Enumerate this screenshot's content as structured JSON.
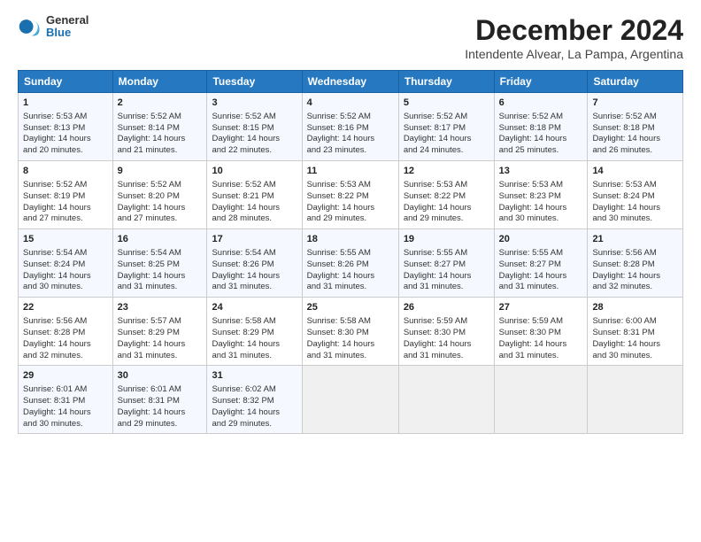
{
  "logo": {
    "general": "General",
    "blue": "Blue"
  },
  "title": "December 2024",
  "subtitle": "Intendente Alvear, La Pampa, Argentina",
  "days_header": [
    "Sunday",
    "Monday",
    "Tuesday",
    "Wednesday",
    "Thursday",
    "Friday",
    "Saturday"
  ],
  "weeks": [
    [
      {
        "day": "1",
        "lines": [
          "Sunrise: 5:53 AM",
          "Sunset: 8:13 PM",
          "Daylight: 14 hours",
          "and 20 minutes."
        ]
      },
      {
        "day": "2",
        "lines": [
          "Sunrise: 5:52 AM",
          "Sunset: 8:14 PM",
          "Daylight: 14 hours",
          "and 21 minutes."
        ]
      },
      {
        "day": "3",
        "lines": [
          "Sunrise: 5:52 AM",
          "Sunset: 8:15 PM",
          "Daylight: 14 hours",
          "and 22 minutes."
        ]
      },
      {
        "day": "4",
        "lines": [
          "Sunrise: 5:52 AM",
          "Sunset: 8:16 PM",
          "Daylight: 14 hours",
          "and 23 minutes."
        ]
      },
      {
        "day": "5",
        "lines": [
          "Sunrise: 5:52 AM",
          "Sunset: 8:17 PM",
          "Daylight: 14 hours",
          "and 24 minutes."
        ]
      },
      {
        "day": "6",
        "lines": [
          "Sunrise: 5:52 AM",
          "Sunset: 8:18 PM",
          "Daylight: 14 hours",
          "and 25 minutes."
        ]
      },
      {
        "day": "7",
        "lines": [
          "Sunrise: 5:52 AM",
          "Sunset: 8:18 PM",
          "Daylight: 14 hours",
          "and 26 minutes."
        ]
      }
    ],
    [
      {
        "day": "8",
        "lines": [
          "Sunrise: 5:52 AM",
          "Sunset: 8:19 PM",
          "Daylight: 14 hours",
          "and 27 minutes."
        ]
      },
      {
        "day": "9",
        "lines": [
          "Sunrise: 5:52 AM",
          "Sunset: 8:20 PM",
          "Daylight: 14 hours",
          "and 27 minutes."
        ]
      },
      {
        "day": "10",
        "lines": [
          "Sunrise: 5:52 AM",
          "Sunset: 8:21 PM",
          "Daylight: 14 hours",
          "and 28 minutes."
        ]
      },
      {
        "day": "11",
        "lines": [
          "Sunrise: 5:53 AM",
          "Sunset: 8:22 PM",
          "Daylight: 14 hours",
          "and 29 minutes."
        ]
      },
      {
        "day": "12",
        "lines": [
          "Sunrise: 5:53 AM",
          "Sunset: 8:22 PM",
          "Daylight: 14 hours",
          "and 29 minutes."
        ]
      },
      {
        "day": "13",
        "lines": [
          "Sunrise: 5:53 AM",
          "Sunset: 8:23 PM",
          "Daylight: 14 hours",
          "and 30 minutes."
        ]
      },
      {
        "day": "14",
        "lines": [
          "Sunrise: 5:53 AM",
          "Sunset: 8:24 PM",
          "Daylight: 14 hours",
          "and 30 minutes."
        ]
      }
    ],
    [
      {
        "day": "15",
        "lines": [
          "Sunrise: 5:54 AM",
          "Sunset: 8:24 PM",
          "Daylight: 14 hours",
          "and 30 minutes."
        ]
      },
      {
        "day": "16",
        "lines": [
          "Sunrise: 5:54 AM",
          "Sunset: 8:25 PM",
          "Daylight: 14 hours",
          "and 31 minutes."
        ]
      },
      {
        "day": "17",
        "lines": [
          "Sunrise: 5:54 AM",
          "Sunset: 8:26 PM",
          "Daylight: 14 hours",
          "and 31 minutes."
        ]
      },
      {
        "day": "18",
        "lines": [
          "Sunrise: 5:55 AM",
          "Sunset: 8:26 PM",
          "Daylight: 14 hours",
          "and 31 minutes."
        ]
      },
      {
        "day": "19",
        "lines": [
          "Sunrise: 5:55 AM",
          "Sunset: 8:27 PM",
          "Daylight: 14 hours",
          "and 31 minutes."
        ]
      },
      {
        "day": "20",
        "lines": [
          "Sunrise: 5:55 AM",
          "Sunset: 8:27 PM",
          "Daylight: 14 hours",
          "and 31 minutes."
        ]
      },
      {
        "day": "21",
        "lines": [
          "Sunrise: 5:56 AM",
          "Sunset: 8:28 PM",
          "Daylight: 14 hours",
          "and 32 minutes."
        ]
      }
    ],
    [
      {
        "day": "22",
        "lines": [
          "Sunrise: 5:56 AM",
          "Sunset: 8:28 PM",
          "Daylight: 14 hours",
          "and 32 minutes."
        ]
      },
      {
        "day": "23",
        "lines": [
          "Sunrise: 5:57 AM",
          "Sunset: 8:29 PM",
          "Daylight: 14 hours",
          "and 31 minutes."
        ]
      },
      {
        "day": "24",
        "lines": [
          "Sunrise: 5:58 AM",
          "Sunset: 8:29 PM",
          "Daylight: 14 hours",
          "and 31 minutes."
        ]
      },
      {
        "day": "25",
        "lines": [
          "Sunrise: 5:58 AM",
          "Sunset: 8:30 PM",
          "Daylight: 14 hours",
          "and 31 minutes."
        ]
      },
      {
        "day": "26",
        "lines": [
          "Sunrise: 5:59 AM",
          "Sunset: 8:30 PM",
          "Daylight: 14 hours",
          "and 31 minutes."
        ]
      },
      {
        "day": "27",
        "lines": [
          "Sunrise: 5:59 AM",
          "Sunset: 8:30 PM",
          "Daylight: 14 hours",
          "and 31 minutes."
        ]
      },
      {
        "day": "28",
        "lines": [
          "Sunrise: 6:00 AM",
          "Sunset: 8:31 PM",
          "Daylight: 14 hours",
          "and 30 minutes."
        ]
      }
    ],
    [
      {
        "day": "29",
        "lines": [
          "Sunrise: 6:01 AM",
          "Sunset: 8:31 PM",
          "Daylight: 14 hours",
          "and 30 minutes."
        ]
      },
      {
        "day": "30",
        "lines": [
          "Sunrise: 6:01 AM",
          "Sunset: 8:31 PM",
          "Daylight: 14 hours",
          "and 29 minutes."
        ]
      },
      {
        "day": "31",
        "lines": [
          "Sunrise: 6:02 AM",
          "Sunset: 8:32 PM",
          "Daylight: 14 hours",
          "and 29 minutes."
        ]
      },
      {
        "day": "",
        "lines": []
      },
      {
        "day": "",
        "lines": []
      },
      {
        "day": "",
        "lines": []
      },
      {
        "day": "",
        "lines": []
      }
    ]
  ]
}
